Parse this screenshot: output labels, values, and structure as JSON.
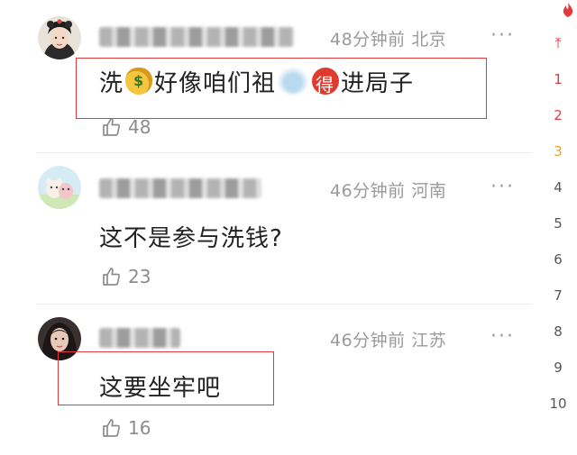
{
  "comments": [
    {
      "text_parts": [
        "洗",
        "好像咱们祖",
        "进局子"
      ],
      "emojis": [
        "money-bag-emoji",
        "blurred-emoji",
        "de-character-emoji"
      ],
      "meta": "48分钟前 北京",
      "likes": "48",
      "more": "···"
    },
    {
      "text": "这不是参与洗钱?",
      "meta": "46分钟前 河南",
      "likes": "23",
      "more": "···"
    },
    {
      "text": "这要坐牢吧",
      "meta": "46分钟前 江苏",
      "likes": "16",
      "more": "···"
    }
  ],
  "sidebar": {
    "top_glyph": "⤒",
    "numbers": [
      "1",
      "2",
      "3",
      "4",
      "5",
      "6",
      "7",
      "8",
      "9",
      "10"
    ]
  },
  "colors": {
    "highlight_box": "#e0393e",
    "meta_text": "#9a9a9a",
    "rank_top": "#e0393e",
    "rank_third": "#f0a020"
  }
}
